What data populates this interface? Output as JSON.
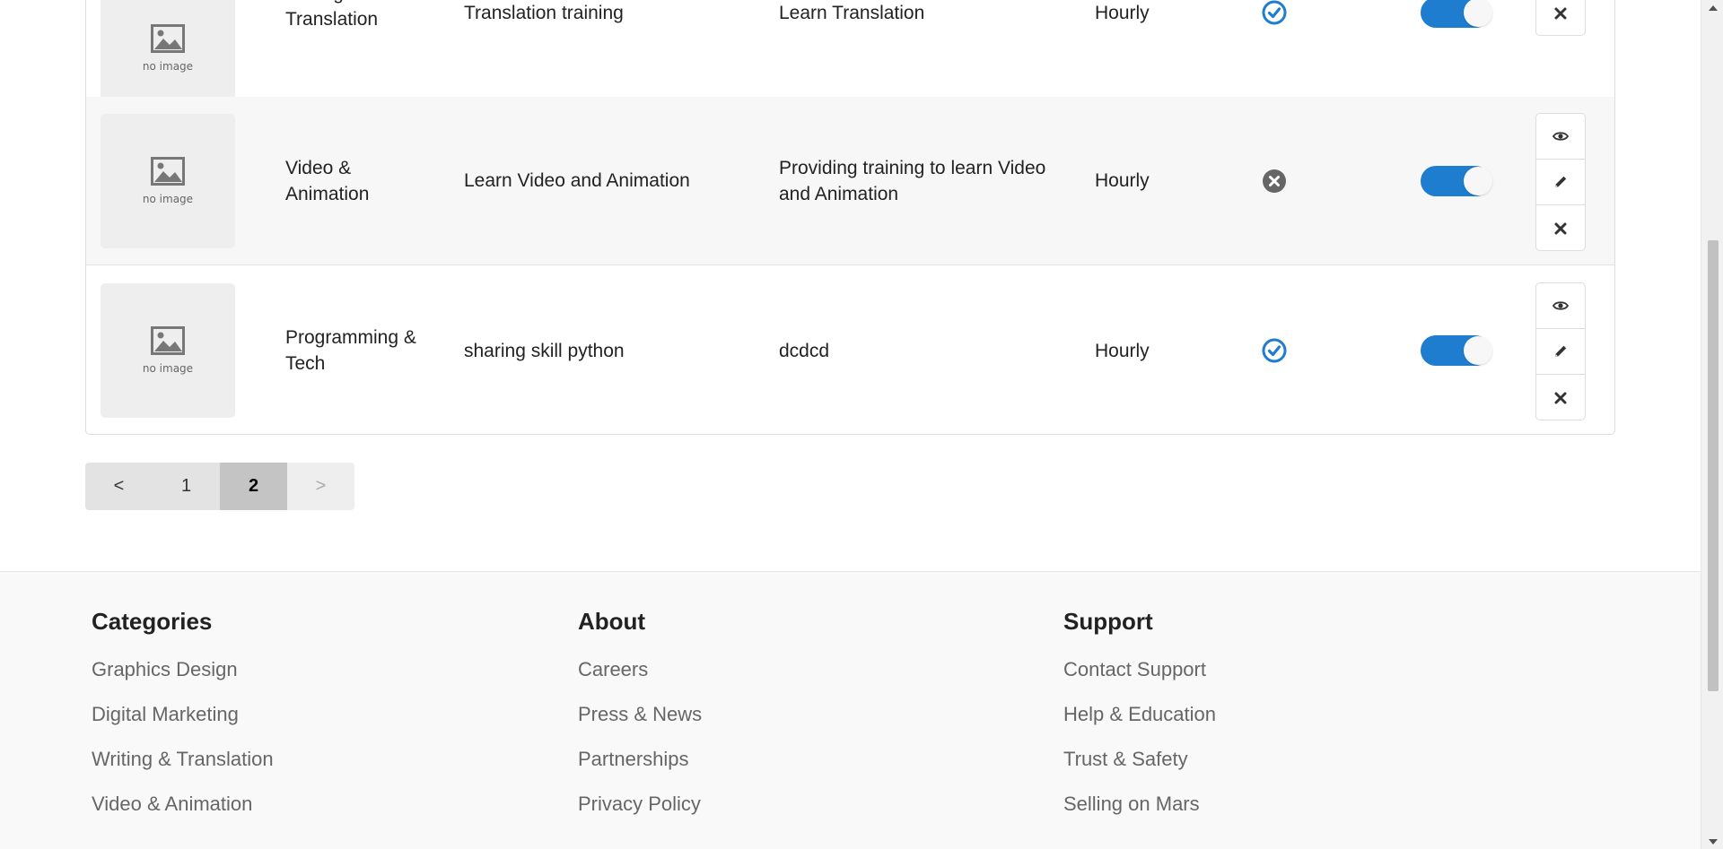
{
  "placeholder_text": "no image",
  "rows": [
    {
      "category": "Writing & Translation",
      "title": "Translation training",
      "description": "Learn Translation",
      "type": "Hourly",
      "approved": true,
      "active": true
    },
    {
      "category": "Video & Animation",
      "title": "Learn Video and Animation",
      "description": "Providing training to learn Video and Animation",
      "type": "Hourly",
      "approved": false,
      "active": true
    },
    {
      "category": "Programming & Tech",
      "title": "sharing skill python",
      "description": "dcdcd",
      "type": "Hourly",
      "approved": true,
      "active": true
    }
  ],
  "pagination": {
    "prev": "<",
    "pages": [
      "1",
      "2"
    ],
    "current": "2",
    "next": ">"
  },
  "footer": {
    "categories": {
      "heading": "Categories",
      "links": [
        "Graphics Design",
        "Digital Marketing",
        "Writing & Translation",
        "Video & Animation"
      ]
    },
    "about": {
      "heading": "About",
      "links": [
        "Careers",
        "Press & News",
        "Partnerships",
        "Privacy Policy"
      ]
    },
    "support": {
      "heading": "Support",
      "links": [
        "Contact Support",
        "Help & Education",
        "Trust & Safety",
        "Selling on Mars"
      ]
    }
  },
  "colors": {
    "accent": "#1f7dd0",
    "rejected": "#666666"
  },
  "icons": {
    "thumbnail": "image-icon",
    "approved": "check-circle-icon",
    "rejected": "x-circle-icon",
    "view": "eye-icon",
    "edit": "pencil-icon",
    "delete": "close-icon"
  }
}
